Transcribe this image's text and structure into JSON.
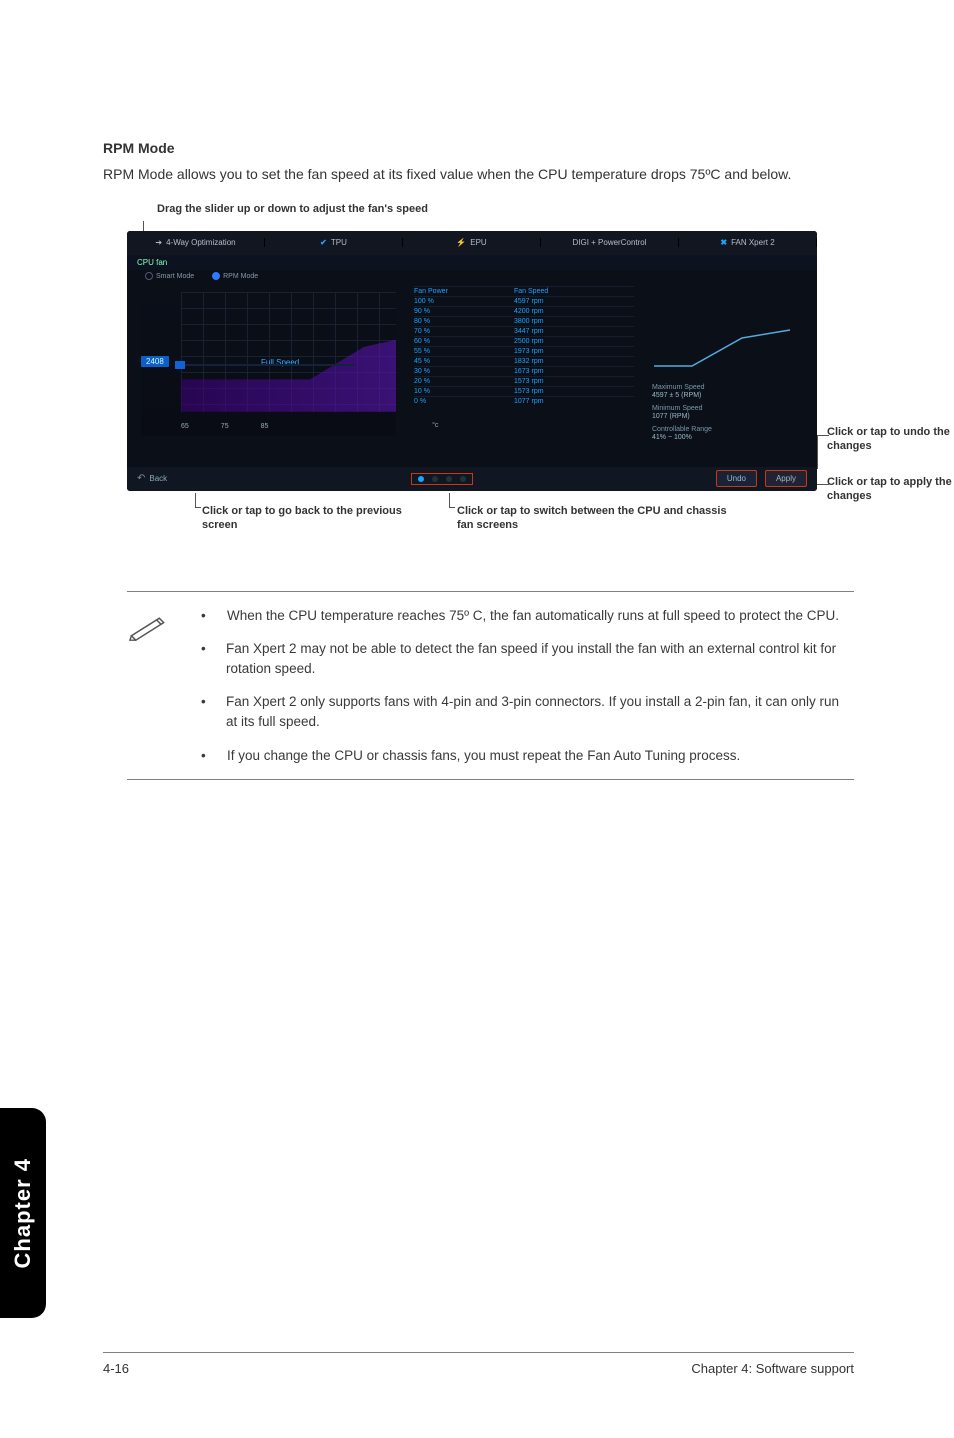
{
  "section": {
    "title": "RPM Mode",
    "body": "RPM Mode allows you to set the fan speed at its fixed value when the CPU temperature drops 75ºC and below."
  },
  "annotations": {
    "top": "Drag the slider up or down to adjust the fan's speed",
    "right_undo": "Click or tap to undo the changes",
    "right_apply": "Click or tap to apply the changes",
    "bottom_back": "Click or tap to go back to the previous screen",
    "bottom_switch": "Click or tap to switch between the CPU and chassis fan screens"
  },
  "screenshot": {
    "tabs": [
      "4-Way Optimization",
      "TPU",
      "EPU",
      "DIGI + PowerControl",
      "FAN Xpert 2"
    ],
    "subtitle": "CPU fan",
    "modes": {
      "smart": "Smart Mode",
      "rpm": "RPM Mode"
    },
    "graph_label": "Full Speed",
    "slider_value": "2408",
    "xaxis": [
      "65",
      "75",
      "85"
    ],
    "xunit": "°c",
    "table": {
      "headers": [
        "Fan Power",
        "Fan Speed"
      ],
      "rows": [
        [
          "100 %",
          "4597 rpm"
        ],
        [
          "90 %",
          "4200 rpm"
        ],
        [
          "80 %",
          "3800 rpm"
        ],
        [
          "70 %",
          "3447 rpm"
        ],
        [
          "60 %",
          "2500 rpm"
        ],
        [
          "55 %",
          "1973 rpm"
        ],
        [
          "45 %",
          "1832 rpm"
        ],
        [
          "30 %",
          "1673 rpm"
        ],
        [
          "20 %",
          "1573 rpm"
        ],
        [
          "10 %",
          "1573 rpm"
        ],
        [
          "0 %",
          "1077 rpm"
        ]
      ]
    },
    "info": {
      "max_label": "Maximum Speed",
      "max_val": "4597 ± 5 (RPM)",
      "min_label": "Minimum Speed",
      "min_val": "1077 (RPM)",
      "range_label": "Controllable Range",
      "range_val": "41% ~ 100%"
    },
    "back": "Back",
    "undo": "Undo",
    "apply": "Apply"
  },
  "notes": [
    "When the CPU temperature reaches 75º C, the fan automatically runs at full speed to protect the CPU.",
    "Fan Xpert 2 may not be able to detect the fan speed if you install the fan with an external control kit for rotation speed.",
    "Fan Xpert 2 only supports fans with 4-pin and 3-pin connectors. If you install a 2-pin fan, it can only run at its full speed.",
    "If you change the CPU or chassis fans, you must repeat the Fan Auto Tuning process."
  ],
  "side_tab": "Chapter 4",
  "footer": {
    "left": "4-16",
    "right": "Chapter 4: Software support"
  }
}
